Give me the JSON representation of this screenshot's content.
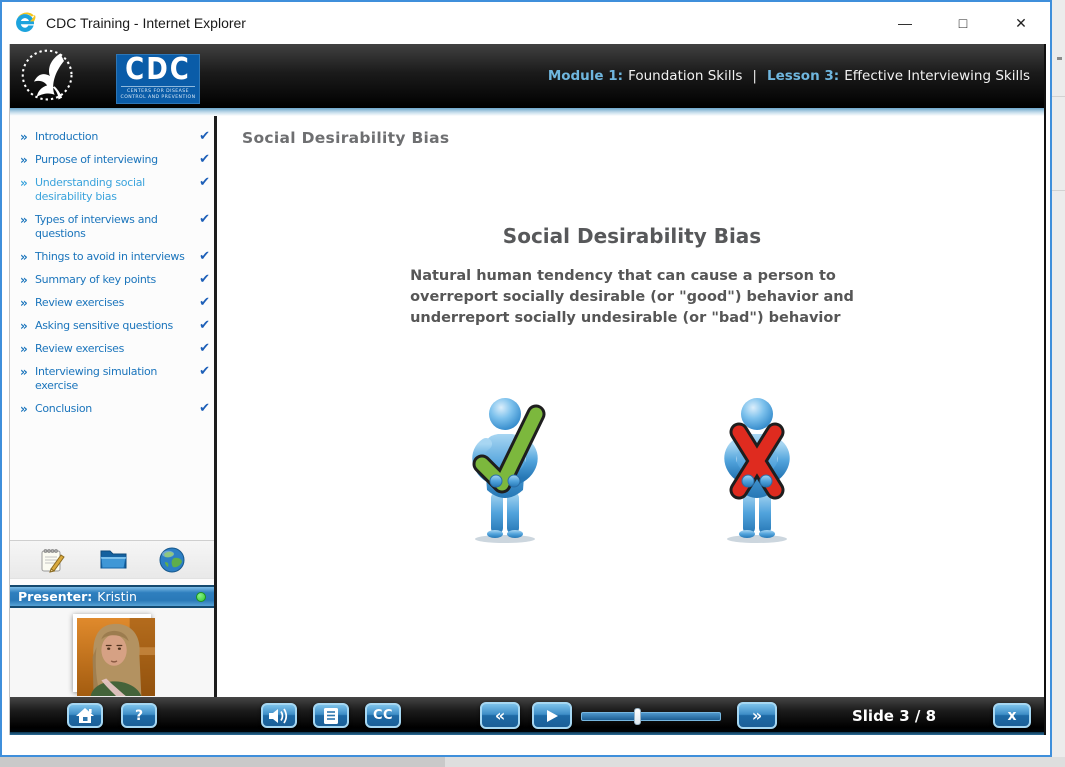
{
  "window": {
    "title": "CDC Training - Internet Explorer",
    "minimize_glyph": "—",
    "maximize_glyph": "□",
    "close_glyph": "✕"
  },
  "header": {
    "module_label": "Module 1:",
    "module_name": "Foundation Skills",
    "divider": "|",
    "lesson_label": "Lesson 3:",
    "lesson_name": "Effective Interviewing Skills",
    "cdc_acronym": "CDC",
    "cdc_tagline_line1": "CENTERS FOR DISEASE",
    "cdc_tagline_line2": "CONTROL AND PREVENTION"
  },
  "glyphs": {
    "bullet": "»",
    "check": "✔",
    "prev": "«",
    "next": "»",
    "help": "?",
    "cc": "CC",
    "exit": "x"
  },
  "sidebar": {
    "items": [
      {
        "label": "Introduction",
        "completed": true,
        "active": false
      },
      {
        "label": "Purpose of interviewing",
        "completed": true,
        "active": false
      },
      {
        "label": "Understanding social desirability bias",
        "completed": true,
        "active": true
      },
      {
        "label": "Types of interviews and questions",
        "completed": true,
        "active": false
      },
      {
        "label": "Things to avoid in interviews",
        "completed": true,
        "active": false
      },
      {
        "label": "Summary of key points",
        "completed": true,
        "active": false
      },
      {
        "label": "Review exercises",
        "completed": true,
        "active": false
      },
      {
        "label": "Asking sensitive questions",
        "completed": true,
        "active": false
      },
      {
        "label": "Review exercises",
        "completed": true,
        "active": false
      },
      {
        "label": "Interviewing simulation exercise",
        "completed": true,
        "active": false
      },
      {
        "label": "Conclusion",
        "completed": true,
        "active": false
      }
    ]
  },
  "presenter": {
    "label": "Presenter:",
    "name": "Kristin"
  },
  "slide": {
    "page_title": "Social Desirability Bias",
    "heading": "Social Desirability Bias",
    "body_line1": "Natural human tendency that can cause a person to",
    "body_line2": "overreport socially desirable (or \"good\") behavior and",
    "body_line3": "underreport socially undesirable (or \"bad\") behavior"
  },
  "player": {
    "slide_counter": "Slide 3 / 8",
    "progress_percent": 40
  },
  "colors": {
    "window_border": "#3f8fdb",
    "cdc_logo_blue": "#0a5ca8",
    "header_label_blue": "#6fb6de",
    "nav_link_blue": "#1b75bc",
    "nav_active_blue": "#3aa3dc",
    "check_blue": "#1d5fb8",
    "button_blue": "#2f7fc1",
    "good_green": "#7cb83d",
    "bad_red": "#df2b1f",
    "online_green": "#2ecc2e"
  }
}
